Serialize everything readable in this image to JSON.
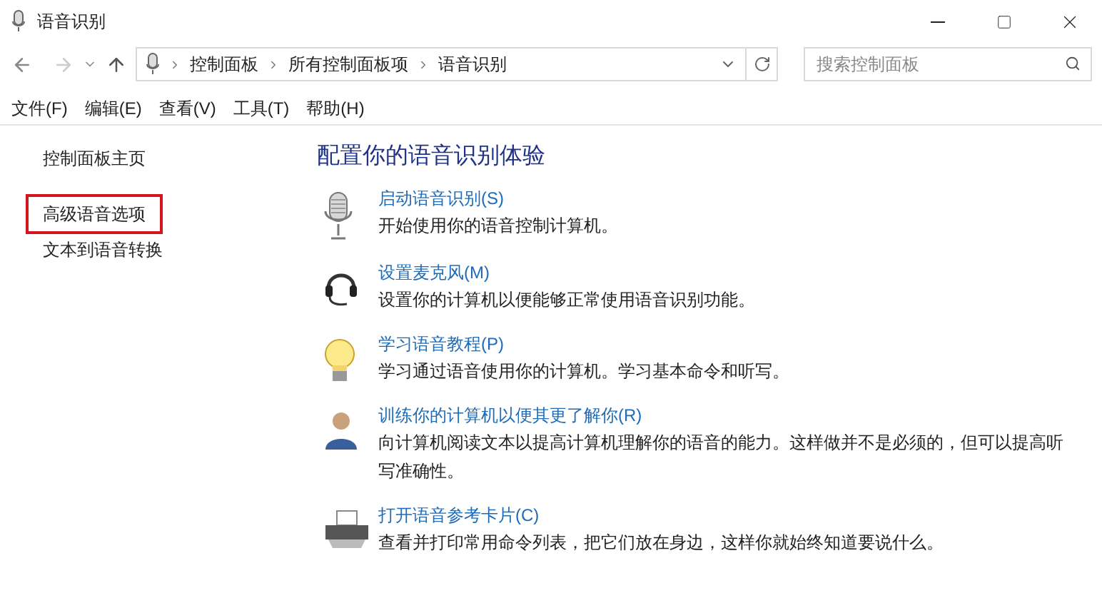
{
  "window": {
    "title": "语音识别"
  },
  "address_bar": {
    "crumbs": [
      "控制面板",
      "所有控制面板项",
      "语音识别"
    ]
  },
  "search": {
    "placeholder": "搜索控制面板"
  },
  "menu": [
    "文件(F)",
    "编辑(E)",
    "查看(V)",
    "工具(T)",
    "帮助(H)"
  ],
  "sidebar": {
    "items": [
      {
        "label": "控制面板主页",
        "highlighted": false
      },
      {
        "label": "高级语音选项",
        "highlighted": true
      },
      {
        "label": "文本到语音转换",
        "highlighted": false
      }
    ]
  },
  "heading": "配置你的语音识别体验",
  "tasks": [
    {
      "kind": "microphone",
      "link": "启动语音识别(S)",
      "description": "开始使用你的语音控制计算机。"
    },
    {
      "kind": "headset",
      "link": "设置麦克风(M)",
      "description": "设置你的计算机以便能够正常使用语音识别功能。"
    },
    {
      "kind": "bulb",
      "link": "学习语音教程(P)",
      "description": "学习通过语音使用你的计算机。学习基本命令和听写。"
    },
    {
      "kind": "person",
      "link": "训练你的计算机以便其更了解你(R)",
      "description": "向计算机阅读文本以提高计算机理解你的语音的能力。这样做并不是必须的，但可以提高听写准确性。"
    },
    {
      "kind": "printer",
      "link": "打开语音参考卡片(C)",
      "description": "查看并打印常用命令列表，把它们放在身边，这样你就始终知道要说什么。"
    }
  ]
}
